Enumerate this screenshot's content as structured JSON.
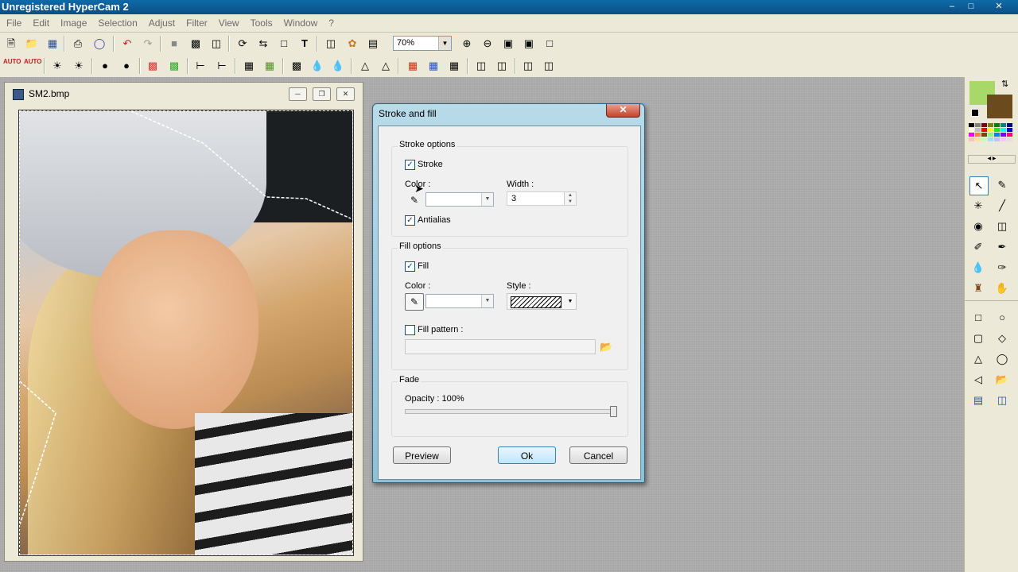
{
  "app": {
    "title": "Unregistered HyperCam 2",
    "window_controls": {
      "minimize": "‒",
      "maximize": "□",
      "close": "✕"
    }
  },
  "menu": [
    "File",
    "Edit",
    "Image",
    "Selection",
    "Adjust",
    "Filter",
    "View",
    "Tools",
    "Window",
    "?"
  ],
  "toolbar1": {
    "zoom_value": "70%",
    "icons": [
      "new-file-icon",
      "open-folder-icon",
      "save-icon",
      "print-icon",
      "scan-icon",
      "undo-icon",
      "redo-icon",
      "crop-icon",
      "resize-icon",
      "color-depth-icon",
      "rotate-icon",
      "flip-icon",
      "select-icon",
      "text-icon",
      "clone-icon",
      "effect-icon",
      "window-icon",
      "zoom-in-icon",
      "zoom-out-icon",
      "fit-window-icon",
      "actual-size-icon",
      "fullscreen-icon"
    ]
  },
  "toolbar2": {
    "auto_labels": [
      "AUTO",
      "AUTO"
    ]
  },
  "image_window": {
    "title": "SM2.bmp"
  },
  "dialog": {
    "title": "Stroke and fill",
    "close_label": "✕",
    "stroke_group": "Stroke options",
    "stroke_label": "Stroke",
    "stroke_checked": true,
    "color_label": "Color :",
    "width_label": "Width :",
    "width_value": "3",
    "antialias_label": "Antialias",
    "antialias_checked": true,
    "fill_group": "Fill options",
    "fill_label": "Fill",
    "fill_checked": true,
    "fill_color_label": "Color :",
    "style_label": "Style :",
    "fill_pattern_label": "Fill pattern :",
    "fill_pattern_checked": false,
    "fade_group": "Fade",
    "opacity_label": "Opacity : 100%",
    "opacity": 1.0,
    "preview_button": "Preview",
    "ok_button": "Ok",
    "cancel_button": "Cancel"
  },
  "palette": {
    "foreground_color": "#a8d868",
    "background_color": "#6b4a1e"
  }
}
